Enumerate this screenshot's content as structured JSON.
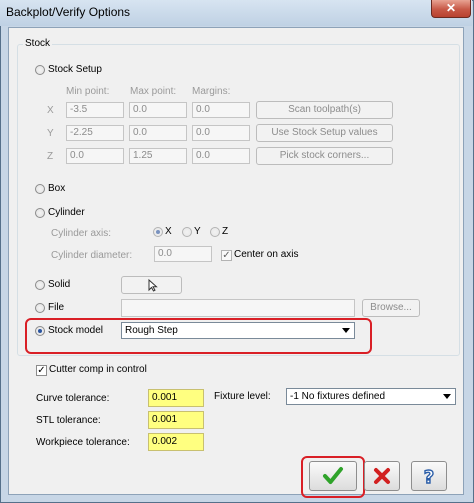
{
  "window": {
    "title": "Backplot/Verify Options",
    "close_glyph": "✕"
  },
  "stock": {
    "group_label": "Stock",
    "stock_setup": {
      "label": "Stock Setup",
      "col_min": "Min point:",
      "col_max": "Max point:",
      "col_margins": "Margins:",
      "rows": [
        {
          "axis": "X",
          "min": "-3.5",
          "max": "0.0",
          "margin": "0.0"
        },
        {
          "axis": "Y",
          "min": "-2.25",
          "max": "0.0",
          "margin": "0.0"
        },
        {
          "axis": "Z",
          "min": "0.0",
          "max": "1.25",
          "margin": "0.0"
        }
      ],
      "buttons": [
        "Scan toolpath(s)",
        "Use Stock Setup values",
        "Pick stock corners..."
      ]
    },
    "box": {
      "label": "Box"
    },
    "cylinder": {
      "label": "Cylinder",
      "axis_label": "Cylinder axis:",
      "axis_options": [
        "X",
        "Y",
        "Z"
      ],
      "axis_selected": "X",
      "diameter_label": "Cylinder diameter:",
      "diameter": "0.0",
      "center_on_axis": "Center on axis",
      "center_checked": true
    },
    "solid": {
      "label": "Solid",
      "select_icon": "cursor-select-icon"
    },
    "file": {
      "label": "File",
      "value": "",
      "browse": "Browse..."
    },
    "stock_model": {
      "label": "Stock model",
      "value": "Rough Step",
      "selected": true
    }
  },
  "cutter_comp": {
    "label": "Cutter comp in control",
    "checked": true
  },
  "tolerances": {
    "curve_label": "Curve tolerance:",
    "curve": "0.001",
    "stl_label": "STL tolerance:",
    "stl": "0.001",
    "workpiece_label": "Workpiece tolerance:",
    "workpiece": "0.002"
  },
  "fixture": {
    "label": "Fixture level:",
    "value": "-1 No fixtures defined"
  },
  "buttons": {
    "ok_glyph": "✔",
    "cancel_glyph": "✖",
    "help_glyph": "?"
  },
  "colors": {
    "highlight": "#d91f26",
    "ok_green": "#2fa32a",
    "cancel_red": "#d22020",
    "help_blue": "#2a5da8",
    "tolerance_yellow": "#ffff80"
  }
}
